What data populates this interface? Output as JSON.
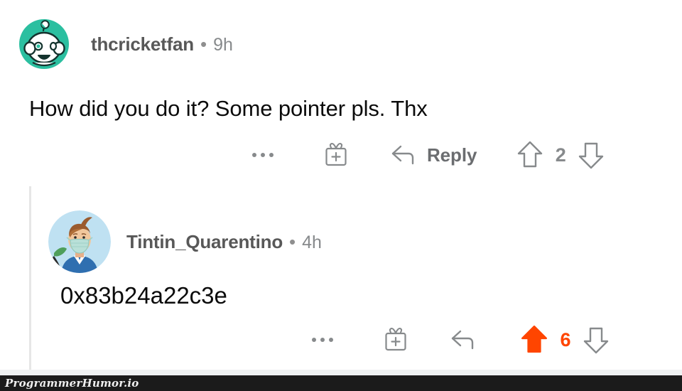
{
  "watermark": {
    "text": "ProgrammerHumor.io",
    "bar_color": "#1b1b1b"
  },
  "colors": {
    "upvote_orange": "#ff4500",
    "icon_gray": "#878a8c",
    "username_gray": "#585858",
    "text_black": "#0b0b0b",
    "thread_line": "#e6e6e6",
    "page_background": "#ffffff"
  },
  "comments": [
    {
      "username": "thcricketfan",
      "separator": "•",
      "timestamp": "9h",
      "body": "How did you do it? Some pointer pls. Thx",
      "avatar_name": "reddit-snoo-avatar",
      "actions": {
        "more_label": "…",
        "award_label": "Give Award",
        "reply_label": "Reply",
        "upvote_label": "Upvote",
        "downvote_label": "Downvote",
        "vote_count": "2",
        "vote_state": "none"
      }
    },
    {
      "username": "Tintin_Quarentino",
      "separator": "•",
      "timestamp": "4h",
      "body": "0x83b24a22c3e",
      "avatar_name": "tintin-masked-avatar",
      "actions": {
        "more_label": "…",
        "award_label": "Give Award",
        "reply_label": "",
        "upvote_label": "Upvote",
        "downvote_label": "Downvote",
        "vote_count": "6",
        "vote_state": "upvoted"
      }
    }
  ]
}
